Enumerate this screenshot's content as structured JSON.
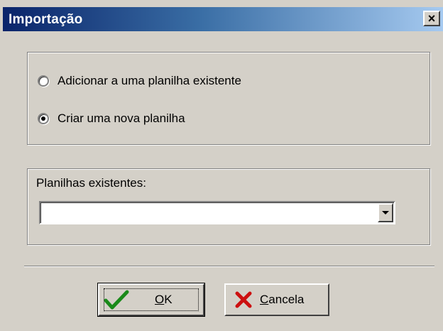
{
  "window": {
    "title": "Importação",
    "close_label": "×"
  },
  "options": {
    "radio_add_label": "Adicionar a uma planilha existente",
    "radio_create_label": "Criar uma nova planilha",
    "selected": "create"
  },
  "sheets": {
    "label": "Planilhas existentes:",
    "value": ""
  },
  "buttons": {
    "ok": {
      "mnemonic": "O",
      "rest": "K"
    },
    "cancel": {
      "mnemonic": "C",
      "rest": "ancela"
    }
  },
  "icons": {
    "ok": "checkmark-icon",
    "cancel": "red-x-icon",
    "close": "close-icon",
    "dropdown": "chevron-down-icon"
  },
  "colors": {
    "dialog_bg": "#d4d0c8",
    "title_gradient_start": "#0a246a",
    "title_gradient_end": "#a6caf0",
    "check_green": "#1a8a1a",
    "x_red": "#cc1010"
  }
}
